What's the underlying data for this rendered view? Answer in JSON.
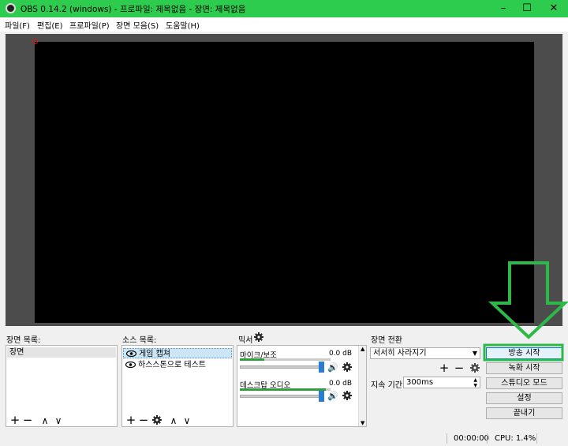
{
  "window": {
    "title": "OBS 0.14.2 (windows) - 프로파일: 제목없음 - 장면: 제목없음",
    "minimize": "–",
    "maximize": "☐",
    "close": "✕"
  },
  "menu": {
    "items": [
      {
        "label": "파일(F)"
      },
      {
        "label": "편집(E)"
      },
      {
        "label": "프로파일(P)"
      },
      {
        "label": "장면 모음(S)"
      },
      {
        "label": "도움말(H)"
      }
    ]
  },
  "scenes": {
    "title": "장면 목록:",
    "items": [
      "장면"
    ],
    "add": "+",
    "remove": "−",
    "up": "∧",
    "down": "∨"
  },
  "sources": {
    "title": "소스 목록:",
    "items": [
      "게임 캡쳐",
      "하스스톤으로 테스트"
    ],
    "add": "+",
    "remove": "−",
    "up": "∧",
    "down": "∨"
  },
  "mixer": {
    "title": "믹서",
    "channels": [
      {
        "name": "마이크/보조",
        "db": "0.0 dB",
        "level": 0.27,
        "volume": 1.0
      },
      {
        "name": "데스크탑 오디오",
        "db": "0.0 dB",
        "level": 0.95,
        "volume": 1.0
      }
    ]
  },
  "transitions": {
    "title": "장면 전환",
    "selected": "서서히 사라지기",
    "add": "+",
    "remove": "−",
    "duration_label": "지속 기간",
    "duration_value": "300ms"
  },
  "controls": {
    "start_streaming": "방송 시작",
    "start_recording": "녹화 시작",
    "studio_mode": "스튜디오 모드",
    "settings": "설정",
    "exit": "끝내기"
  },
  "status": {
    "time": "00:00:00",
    "cpu": "CPU: 1.4%"
  },
  "colors": {
    "titlebar": "#2ecc4e",
    "annotation": "#2db84a",
    "preview_bg": "#000000",
    "canvas_bg": "#4c4c4c"
  }
}
